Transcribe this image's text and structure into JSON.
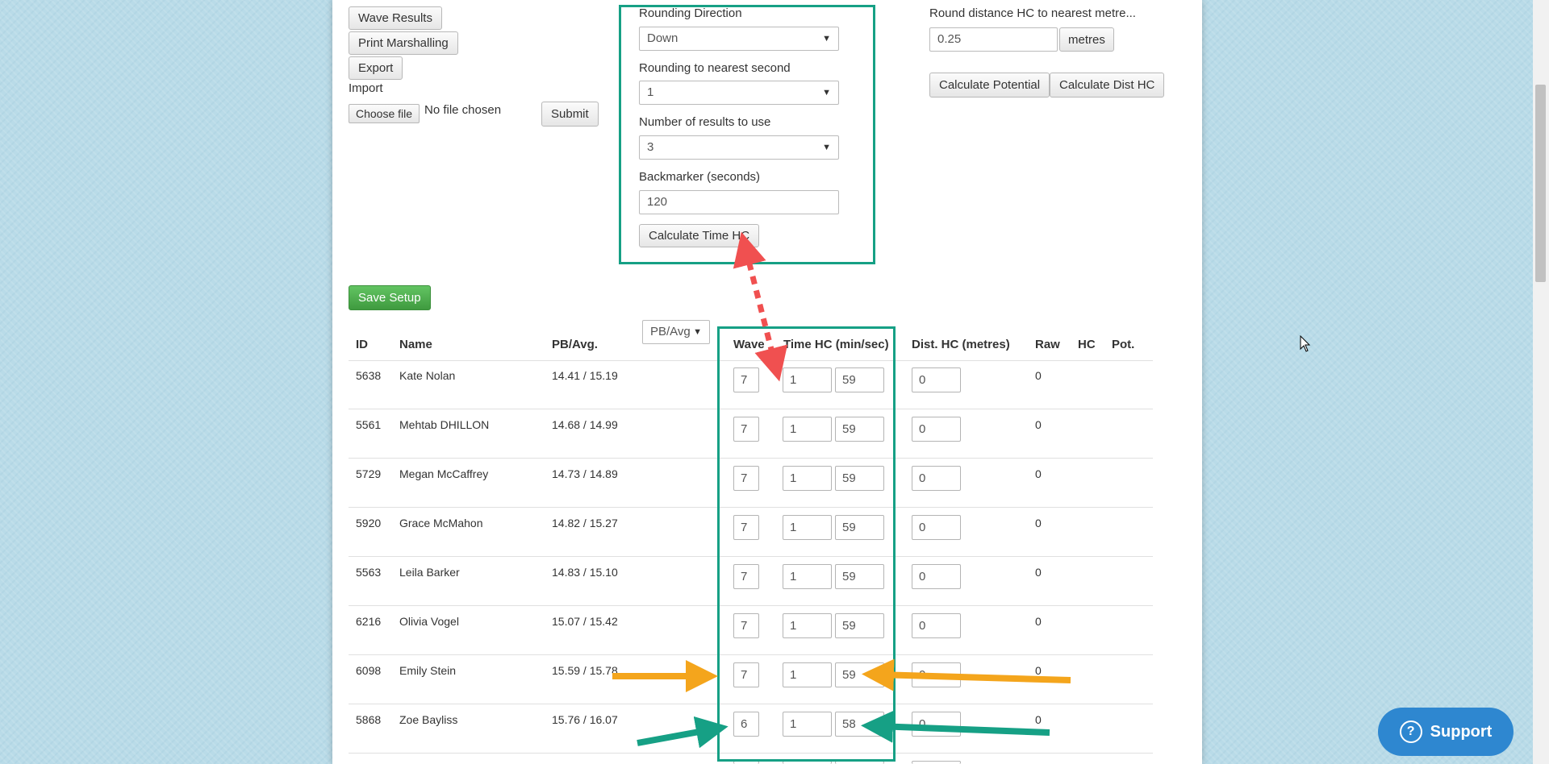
{
  "left_controls": {
    "wave_results": "Wave Results",
    "print_marshalling": "Print Marshalling",
    "export": "Export",
    "import_label": "Import",
    "choose_file": "Choose file",
    "no_file": "No file chosen",
    "submit": "Submit"
  },
  "time_hc": {
    "rounding_direction_label": "Rounding Direction",
    "rounding_direction_value": "Down",
    "rounding_second_label": "Rounding to nearest second",
    "rounding_second_value": "1",
    "num_results_label": "Number of results to use",
    "num_results_value": "3",
    "backmarker_label": "Backmarker (seconds)",
    "backmarker_value": "120",
    "calculate_time_hc": "Calculate Time HC"
  },
  "dist_hc": {
    "round_label": "Round distance HC to nearest metre...",
    "round_value": "0.25",
    "unit": "metres",
    "calculate_potential": "Calculate Potential",
    "calculate_dist_hc": "Calculate Dist HC"
  },
  "save_setup": "Save Setup",
  "pb_select": "PB/Avg",
  "table": {
    "headers": {
      "id": "ID",
      "name": "Name",
      "pb": "PB/Avg.",
      "wave": "Wave",
      "time_hc": "Time HC (min/sec)",
      "dist_hc": "Dist. HC (metres)",
      "raw": "Raw",
      "hc": "HC",
      "pot": "Pot."
    },
    "rows": [
      {
        "id": "5638",
        "name": "Kate Nolan",
        "pb": "14.41 / 15.19",
        "wave": "7",
        "min": "1",
        "sec": "59",
        "dist": "0",
        "raw": "0"
      },
      {
        "id": "5561",
        "name": "Mehtab DHILLON",
        "pb": "14.68 / 14.99",
        "wave": "7",
        "min": "1",
        "sec": "59",
        "dist": "0",
        "raw": "0"
      },
      {
        "id": "5729",
        "name": "Megan McCaffrey",
        "pb": "14.73 / 14.89",
        "wave": "7",
        "min": "1",
        "sec": "59",
        "dist": "0",
        "raw": "0"
      },
      {
        "id": "5920",
        "name": "Grace McMahon",
        "pb": "14.82 / 15.27",
        "wave": "7",
        "min": "1",
        "sec": "59",
        "dist": "0",
        "raw": "0"
      },
      {
        "id": "5563",
        "name": "Leila Barker",
        "pb": "14.83 / 15.10",
        "wave": "7",
        "min": "1",
        "sec": "59",
        "dist": "0",
        "raw": "0"
      },
      {
        "id": "6216",
        "name": "Olivia Vogel",
        "pb": "15.07 / 15.42",
        "wave": "7",
        "min": "1",
        "sec": "59",
        "dist": "0",
        "raw": "0"
      },
      {
        "id": "6098",
        "name": "Emily Stein",
        "pb": "15.59 / 15.78",
        "wave": "7",
        "min": "1",
        "sec": "59",
        "dist": "0",
        "raw": "0"
      },
      {
        "id": "5868",
        "name": "Zoe Bayliss",
        "pb": "15.76 / 16.07",
        "wave": "6",
        "min": "1",
        "sec": "58",
        "dist": "0",
        "raw": "0"
      }
    ]
  },
  "support": "Support",
  "colors": {
    "highlight_frame": "#16a085",
    "arrow_red": "#f05050",
    "arrow_orange": "#f4a51c",
    "arrow_teal": "#16a085",
    "support_button": "#2e87d0",
    "save_button": "#4cae4c"
  }
}
